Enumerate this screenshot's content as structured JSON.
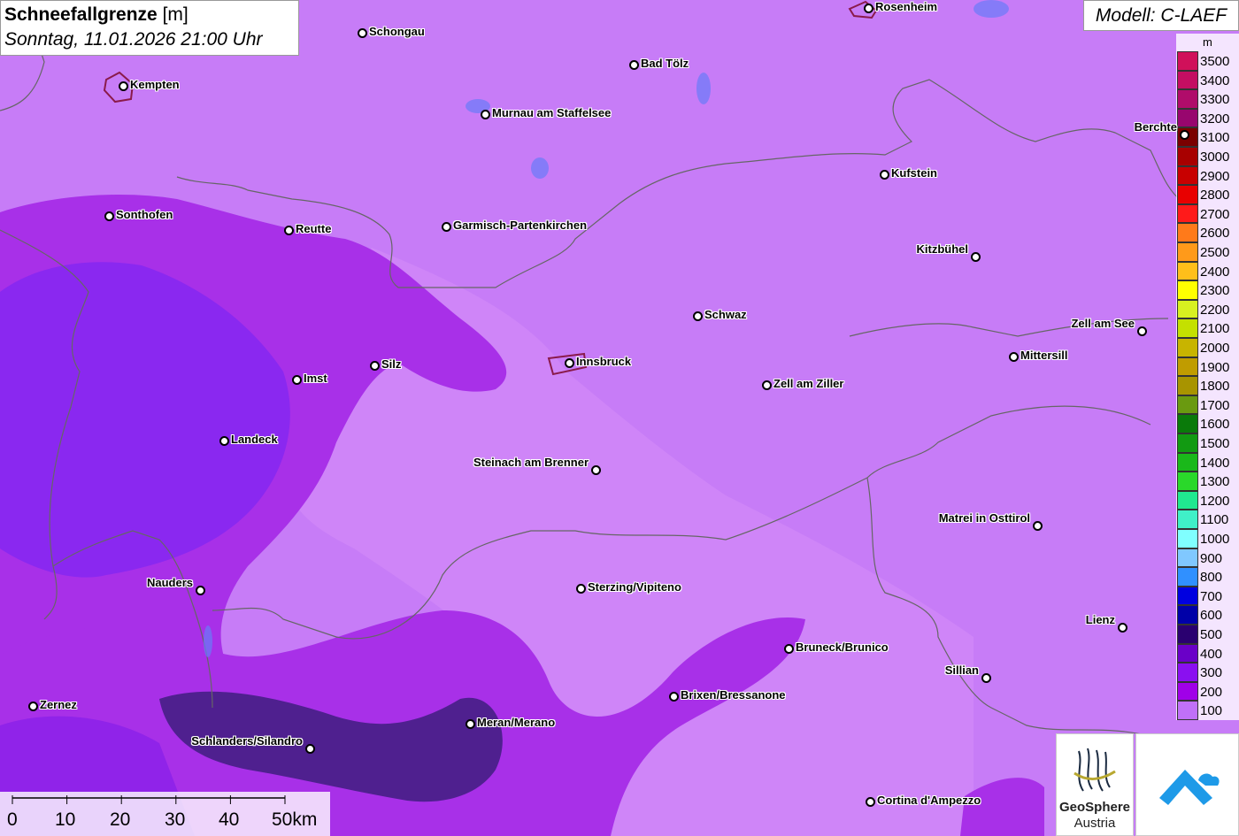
{
  "header": {
    "title": "Schneefallgrenze",
    "unit": "[m]",
    "datetime": "Sonntag, 11.01.2026 21:00 Uhr"
  },
  "model": {
    "label": "Modell: C-LAEF"
  },
  "legend": {
    "unit": "m",
    "levels": [
      {
        "label": "3500",
        "color": "#d0105a"
      },
      {
        "label": "3400",
        "color": "#c40e62"
      },
      {
        "label": "3300",
        "color": "#b00c6a"
      },
      {
        "label": "3200",
        "color": "#98066e"
      },
      {
        "label": "3100",
        "color": "#7a0000"
      },
      {
        "label": "3000",
        "color": "#a80000"
      },
      {
        "label": "2900",
        "color": "#c80000"
      },
      {
        "label": "2800",
        "color": "#e80000"
      },
      {
        "label": "2700",
        "color": "#ff1a1a"
      },
      {
        "label": "2600",
        "color": "#ff7a1a"
      },
      {
        "label": "2500",
        "color": "#ff9a1a"
      },
      {
        "label": "2400",
        "color": "#ffbf1a"
      },
      {
        "label": "2300",
        "color": "#ffff00"
      },
      {
        "label": "2200",
        "color": "#d8f020"
      },
      {
        "label": "2100",
        "color": "#c4e000"
      },
      {
        "label": "2000",
        "color": "#c8b400"
      },
      {
        "label": "1900",
        "color": "#c09c00"
      },
      {
        "label": "1800",
        "color": "#a89400"
      },
      {
        "label": "1700",
        "color": "#6a9a10"
      },
      {
        "label": "1600",
        "color": "#0a7a0a"
      },
      {
        "label": "1500",
        "color": "#129a12"
      },
      {
        "label": "1400",
        "color": "#1ab81a"
      },
      {
        "label": "1300",
        "color": "#2ad82a"
      },
      {
        "label": "1200",
        "color": "#20e890"
      },
      {
        "label": "1100",
        "color": "#40f0c8"
      },
      {
        "label": "1000",
        "color": "#80ffff"
      },
      {
        "label": "900",
        "color": "#80c8ff"
      },
      {
        "label": "800",
        "color": "#3090ff"
      },
      {
        "label": "700",
        "color": "#0000e0"
      },
      {
        "label": "600",
        "color": "#0000a8"
      },
      {
        "label": "500",
        "color": "#2a0070"
      },
      {
        "label": "400",
        "color": "#6a00c8"
      },
      {
        "label": "300",
        "color": "#8a10f0"
      },
      {
        "label": "200",
        "color": "#a000e8"
      },
      {
        "label": "100",
        "color": "#c070f8"
      }
    ]
  },
  "cities": [
    {
      "name": "Rosenheim"
    },
    {
      "name": "Schongau"
    },
    {
      "name": "Kempten"
    },
    {
      "name": "Bad Tölz"
    },
    {
      "name": "Murnau am Staffelsee"
    },
    {
      "name": "Berchte"
    },
    {
      "name": "Kufstein"
    },
    {
      "name": "Sonthofen"
    },
    {
      "name": "Reutte"
    },
    {
      "name": "Garmisch-Partenkirchen"
    },
    {
      "name": "Kitzbühel"
    },
    {
      "name": "Schwaz"
    },
    {
      "name": "Zell am See"
    },
    {
      "name": "Mittersill"
    },
    {
      "name": "Innsbruck"
    },
    {
      "name": "Silz"
    },
    {
      "name": "Imst"
    },
    {
      "name": "Zell am Ziller"
    },
    {
      "name": "Landeck"
    },
    {
      "name": "Steinach am Brenner"
    },
    {
      "name": "Matrei in Osttirol"
    },
    {
      "name": "Nauders"
    },
    {
      "name": "Sterzing/Vipiteno"
    },
    {
      "name": "Lienz"
    },
    {
      "name": "Bruneck/Brunico"
    },
    {
      "name": "Sillian"
    },
    {
      "name": "Brixen/Bressanone"
    },
    {
      "name": "Zernez"
    },
    {
      "name": "Meran/Merano"
    },
    {
      "name": "Schlanders/Silandro"
    },
    {
      "name": "Cortina d'Ampezzo"
    }
  ],
  "scalebar": {
    "labels": [
      "0",
      "10",
      "20",
      "30",
      "40",
      "50km"
    ]
  },
  "logos": {
    "geosphere_line1": "GeoSphere",
    "geosphere_line2": "Austria"
  }
}
